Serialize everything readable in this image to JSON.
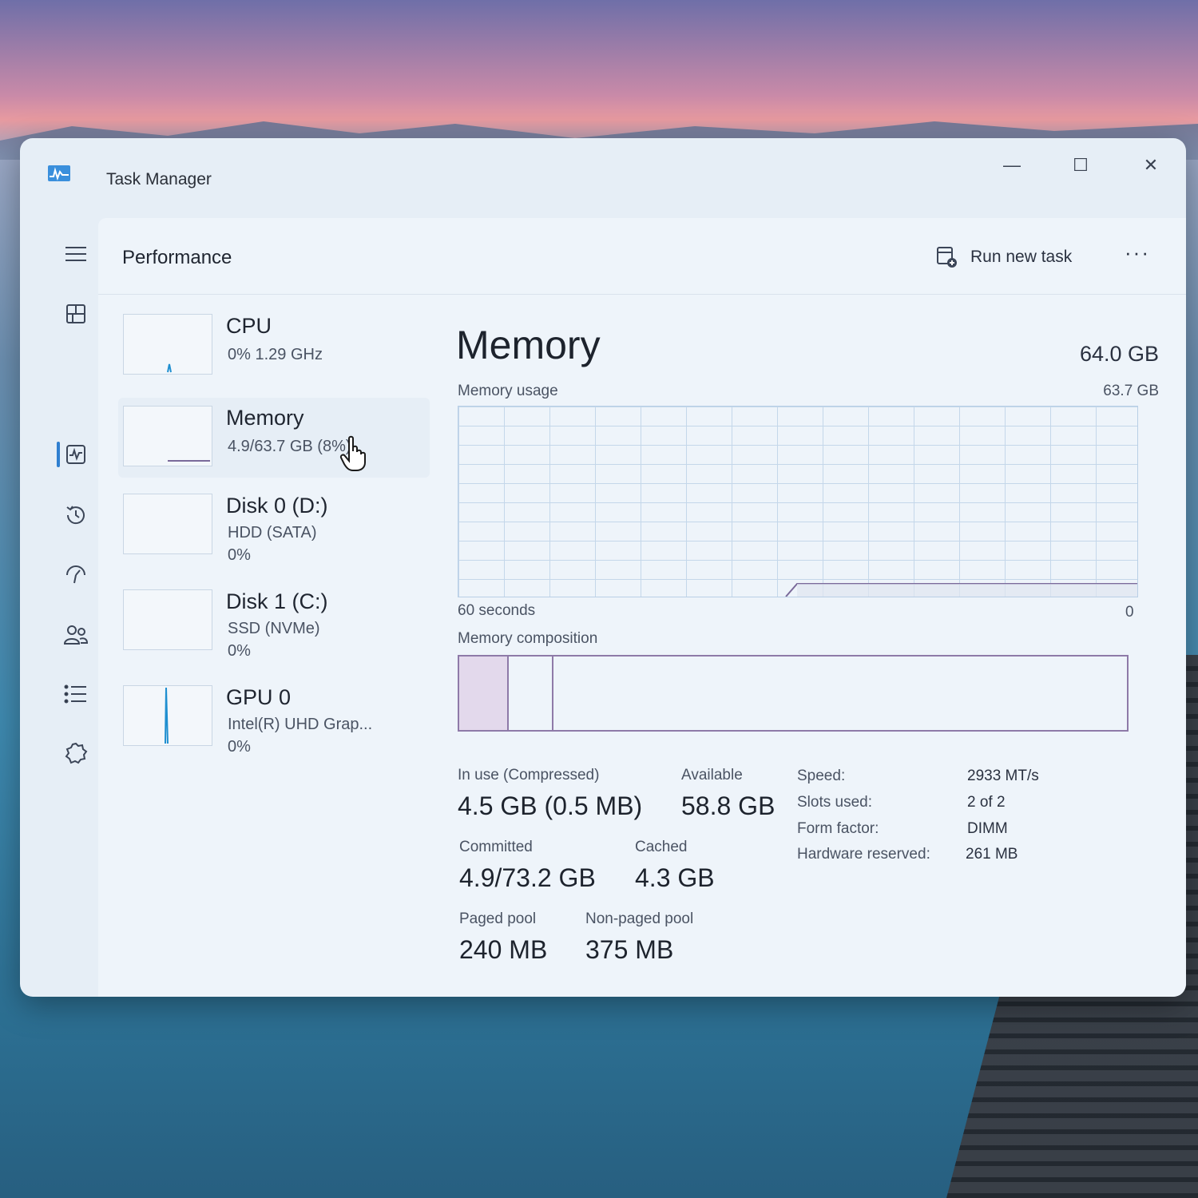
{
  "window": {
    "title": "Task Manager",
    "controls": {
      "minimize": "—",
      "maximize": "☐",
      "close": "✕"
    }
  },
  "nav": {
    "items": [
      {
        "icon": "hamburger-icon"
      },
      {
        "icon": "processes-icon"
      },
      {
        "icon": "performance-icon",
        "active": true
      },
      {
        "icon": "app-history-icon"
      },
      {
        "icon": "startup-apps-icon"
      },
      {
        "icon": "users-icon"
      },
      {
        "icon": "details-icon"
      },
      {
        "icon": "services-icon"
      }
    ],
    "settings_icon": "gear-icon"
  },
  "header": {
    "page_title": "Performance",
    "run_new_task": "Run new task",
    "more": "···"
  },
  "resources": [
    {
      "name": "CPU",
      "line1": "0%  1.29 GHz",
      "line2": ""
    },
    {
      "name": "Memory",
      "line1": "4.9/63.7 GB (8%)",
      "line2": "",
      "selected": true
    },
    {
      "name": "Disk 0 (D:)",
      "line1": "HDD (SATA)",
      "line2": "0%"
    },
    {
      "name": "Disk 1 (C:)",
      "line1": "SSD (NVMe)",
      "line2": "0%"
    },
    {
      "name": "GPU 0",
      "line1": "Intel(R) UHD Grap...",
      "line2": "0%"
    }
  ],
  "memory": {
    "title": "Memory",
    "total": "64.0 GB",
    "usage_label": "Memory usage",
    "usage_max": "63.7 GB",
    "time_label": "60 seconds",
    "time_end": "0",
    "composition_label": "Memory composition",
    "in_use_label": "In use (Compressed)",
    "in_use_value": "4.5 GB (0.5 MB)",
    "available_label": "Available",
    "available_value": "58.8 GB",
    "committed_label": "Committed",
    "committed_value": "4.9/73.2 GB",
    "cached_label": "Cached",
    "cached_value": "4.3 GB",
    "paged_label": "Paged pool",
    "paged_value": "240 MB",
    "nonpaged_label": "Non-paged pool",
    "nonpaged_value": "375 MB",
    "specs": [
      {
        "key": "Speed:",
        "value": "2933 MT/s"
      },
      {
        "key": "Slots used:",
        "value": "2 of 2"
      },
      {
        "key": "Form factor:",
        "value": "DIMM"
      },
      {
        "key": "Hardware reserved:",
        "value": "261 MB"
      }
    ]
  }
}
